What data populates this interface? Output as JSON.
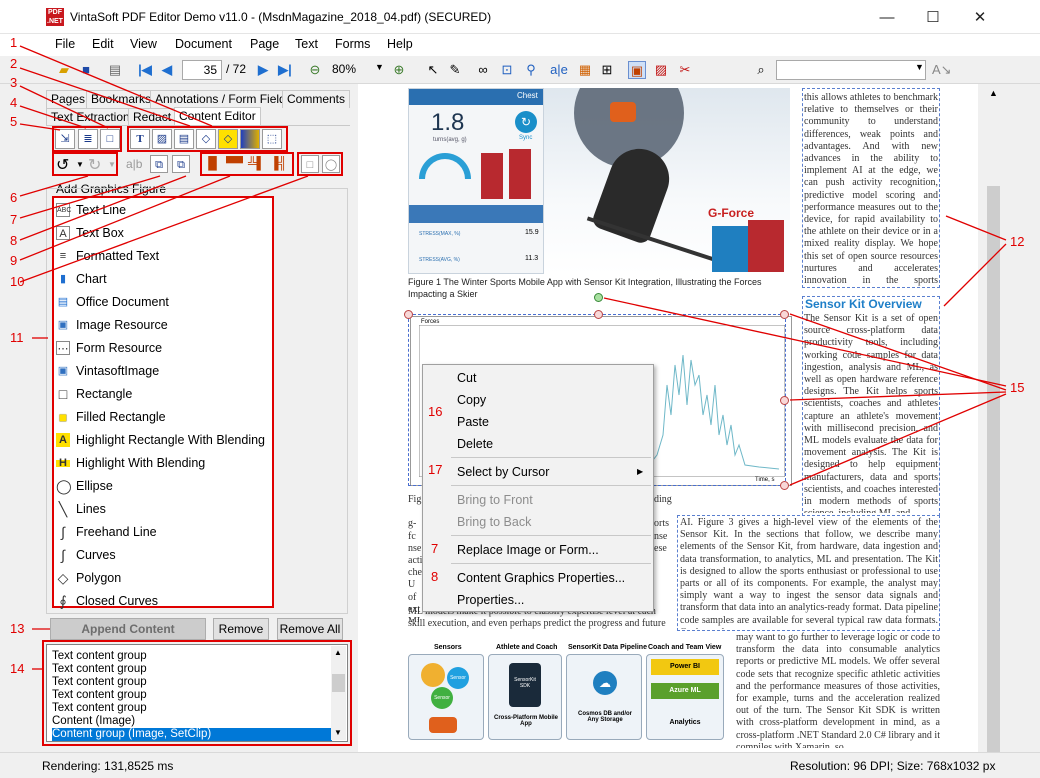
{
  "window": {
    "app_icon_text": "PDF .NET",
    "title": "VintaSoft PDF Editor Demo v11.0 -  (MsdnMagazine_2018_04.pdf) (SECURED)",
    "minimize": "—",
    "maximize": "☐",
    "close": "✕"
  },
  "menu": [
    "File",
    "Edit",
    "View",
    "Document",
    "Page",
    "Text",
    "Forms",
    "Help"
  ],
  "toolbar": {
    "page_number": "35",
    "page_total": "/ 72",
    "zoom": "80%",
    "search_value": ""
  },
  "tabs_row1": [
    "Pages",
    "Bookmarks",
    "Annotations / Form Fields",
    "Comments"
  ],
  "tabs_row2": [
    "Text Extraction",
    "Redact",
    "Content Editor"
  ],
  "callouts": [
    "1",
    "2",
    "3",
    "4",
    "5",
    "6",
    "7",
    "8",
    "9",
    "10",
    "11",
    "12",
    "13",
    "14",
    "15",
    "16",
    "17"
  ],
  "add_graphics_label": "Add Graphics Figure",
  "graphics_figures": [
    {
      "label": "Text Line",
      "icon": "ABC"
    },
    {
      "label": "Text Box",
      "icon": "A"
    },
    {
      "label": "Formatted Text",
      "icon": "≡"
    },
    {
      "label": "Chart",
      "icon": "▮"
    },
    {
      "label": "Office Document",
      "icon": "▤"
    },
    {
      "label": "Image Resource",
      "icon": "▣"
    },
    {
      "label": "Form Resource",
      "icon": "⋯"
    },
    {
      "label": "VintasoftImage",
      "icon": "▣"
    },
    {
      "label": "Rectangle",
      "icon": "□"
    },
    {
      "label": "Filled Rectangle",
      "icon": "■"
    },
    {
      "label": "Highlight Rectangle With Blending",
      "icon": "A"
    },
    {
      "label": "Highlight With Blending",
      "icon": "H"
    },
    {
      "label": "Ellipse",
      "icon": "◯"
    },
    {
      "label": "Lines",
      "icon": "╲"
    },
    {
      "label": "Freehand Line",
      "icon": "∫"
    },
    {
      "label": "Curves",
      "icon": "∫"
    },
    {
      "label": "Polygon",
      "icon": "◇"
    },
    {
      "label": "Closed Curves",
      "icon": "∮"
    }
  ],
  "buttons": {
    "append": "Append Content",
    "remove": "Remove",
    "remove_all": "Remove All"
  },
  "content_groups": [
    "Text content group",
    "Text content group",
    "Text content group",
    "Text content group",
    "Text content group",
    "Content (Image)",
    "Content group (Image, SetClip)"
  ],
  "context_menu": {
    "cut": "Cut",
    "copy": "Copy",
    "paste": "Paste",
    "delete": "Delete",
    "select_by_cursor": "Select by Cursor",
    "bring_to_front": "Bring to Front",
    "bring_to_back": "Bring to Back",
    "replace": "Replace Image or Form...",
    "content_graphics_properties": "Content Graphics Properties...",
    "properties": "Properties..."
  },
  "document": {
    "app_value": "1.8",
    "app_unit": "turns(avg, g)",
    "app_row1_label": "STRESS(MAX, %)",
    "app_row1_value": "15.9",
    "app_row2_label": "STRESS(AVG, %)",
    "app_row2_value": "11.3",
    "app_tab": "Chest",
    "app_sync": "Sync",
    "gforce_label": "G-Force",
    "figure1_caption": "Figure 1 The Winter Sports Mobile App with Sensor Kit Integration, Illustrating the Forces Impacting a Skier",
    "chart_label_forces": "Forces",
    "chart_label_time": "Time, s",
    "right_col_top": "this allows athletes to benchmark relative to themselves or their community to understand differences, weak points and advantages. And with new advances in the ability to implement AI at the edge, we can push activity recognition, predictive model scoring and performance measures out to the device, for rapid availability to the athlete on their device or in a mixed reality display. We hope this set of open source resources nurtures and accelerates innovation in the sports community.",
    "section_heading": "Sensor Kit Overview",
    "right_col_mid": "The Sensor Kit is a set of open source cross-platform data productivity tools, including working code samples for data ingestion, analysis and ML, as well as open hardware reference designs. The Kit helps sports scientists, coaches and athletes capture an athlete's movement with millisecond precision, and ML models evaluate the data for movement analysis. The Kit is designed to help equipment manufacturers, data and sports scientists, and coaches interested in modern methods of sports science, including ML and",
    "center_text": "AI. Figure 3 gives a high-level view of the elements of the Sensor Kit. In the sections that follow, we describe many elements of the Sensor Kit, from hardware, data ingestion and data transformation, to analytics, ML and presentation.     The Kit is designed to allow the sports enthusiast or professional to use parts or all of its components. For example, the analyst may simply want a way to ingest the sensor data signals and transform that data into an analytics-ready format. Data pipeline code samples are available for several typical raw data formats. Or the analyst",
    "right_col_bottom": "may want to go further to leverage logic or code to transform the data into consumable analytics reports or predictive ML models. We offer several code sets that recognize specific athletic activities and the performance measures of those activities, for example, turns and the acceleration realized out of the turn. The Sensor Kit SDK is written with cross-platform development in mind, as a cross-platform .NET Standard 2.0 C# library and it compiles with Xamarin, so",
    "left_text_bottom": "ML models make it possible to classify expertise level at each skill execution, and even perhaps predict the progress and future",
    "diagram_headers": [
      "Sensors",
      "Athlete and Coach",
      "SensorKit Data Pipeline",
      "Coach and Team View"
    ],
    "diagram_labels": [
      "Sensor",
      "Sensor",
      "SensorKit SDK",
      "Cross-Platform Mobile App",
      "Cosmos DB and/or Any Storage",
      "Power BI",
      "Azure ML",
      "Analytics"
    ]
  },
  "status": {
    "rendering": "Rendering: 131,8525 ms",
    "resolution": "Resolution: 96 DPI; Size: 768x1032 px"
  }
}
